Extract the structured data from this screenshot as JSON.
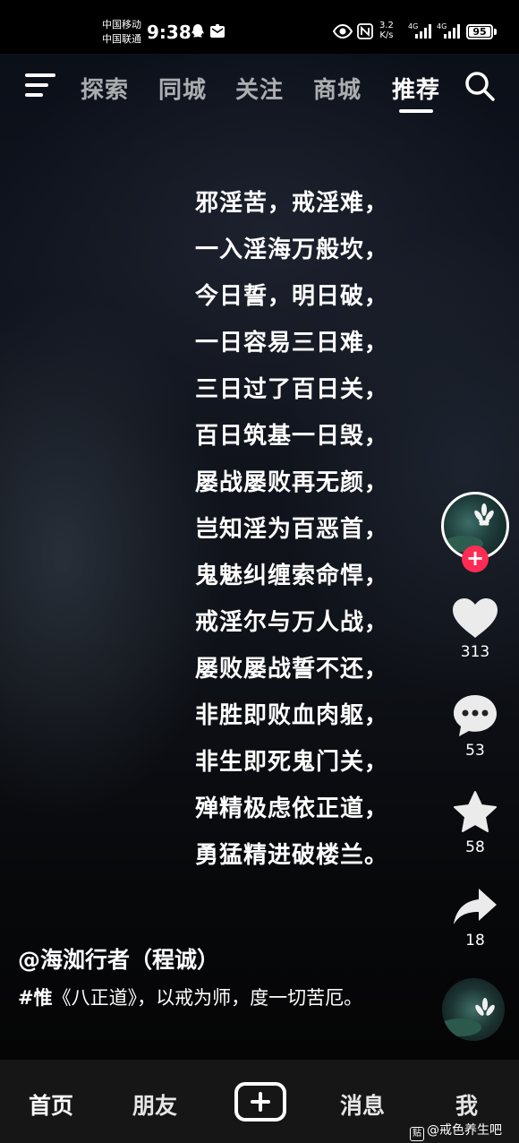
{
  "status_bar": {
    "carrier_1": "中国移动",
    "carrier_2": "中国联通",
    "time": "9:38",
    "net_speed_value": "3.2",
    "net_speed_unit": "K/s",
    "network_type": "4G",
    "battery": "95"
  },
  "top_nav": {
    "tabs": [
      {
        "label": "探索"
      },
      {
        "label": "同城"
      },
      {
        "label": "关注"
      },
      {
        "label": "商城"
      },
      {
        "label": "推荐"
      }
    ],
    "active_tab": "推荐"
  },
  "poem": {
    "lines": [
      "邪淫苦，戒淫难，",
      "一入淫海万般坎，",
      "今日誓，明日破，",
      "一日容易三日难，",
      "三日过了百日关，",
      "百日筑基一日毁，",
      "屡战屡败再无颜，",
      "岂知淫为百恶首，",
      "鬼魅纠缠索命悍，",
      "戒淫尔与万人战，",
      "屡败屡战誓不还，",
      "非胜即败血肉躯，",
      "非生即死鬼门关，",
      "殚精极虑依正道，",
      "勇猛精进破楼兰。"
    ]
  },
  "actions": {
    "likes": "313",
    "comments": "53",
    "favorites": "58",
    "shares": "18"
  },
  "caption": {
    "author": "@海洳行者（程诚）",
    "hashtag": "#惟",
    "text": "《八正道》，以戒为师，度一切苦厄。"
  },
  "bottom_nav": {
    "home": "首页",
    "friends": "朋友",
    "messages": "消息",
    "me": "我"
  },
  "watermark": {
    "logo": "贴",
    "text": "@戒色养生吧"
  },
  "colors": {
    "follow_accent": "#fe2c55",
    "bottom_bar": "#161616"
  }
}
